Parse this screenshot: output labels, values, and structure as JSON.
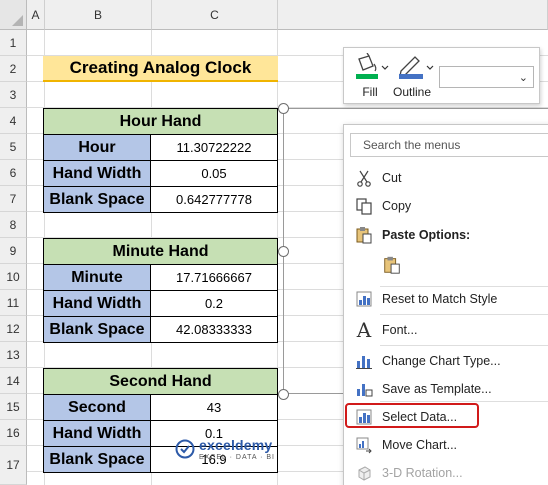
{
  "sheet": {
    "columns": [
      "A",
      "B",
      "C"
    ],
    "rows": [
      "1",
      "2",
      "3",
      "4",
      "5",
      "6",
      "7",
      "8",
      "9",
      "10",
      "11",
      "12",
      "13",
      "14",
      "15",
      "16",
      "17"
    ],
    "title": "Creating Analog Clock"
  },
  "tables": {
    "hour": {
      "header": "Hour Hand",
      "rows": [
        {
          "label": "Hour",
          "value": "11.30722222"
        },
        {
          "label": "Hand Width",
          "value": "0.05"
        },
        {
          "label": "Blank Space",
          "value": "0.642777778"
        }
      ]
    },
    "minute": {
      "header": "Minute Hand",
      "rows": [
        {
          "label": "Minute",
          "value": "17.71666667"
        },
        {
          "label": "Hand Width",
          "value": "0.2"
        },
        {
          "label": "Blank Space",
          "value": "42.08333333"
        }
      ]
    },
    "second": {
      "header": "Second Hand",
      "rows": [
        {
          "label": "Second",
          "value": "43"
        },
        {
          "label": "Hand Width",
          "value": "0.1"
        },
        {
          "label": "Blank Space",
          "value": "16.9"
        }
      ]
    }
  },
  "mini_toolbar": {
    "fill_label": "Fill",
    "outline_label": "Outline",
    "fill_color": "#00b050",
    "outline_color": "#4472c4"
  },
  "context_menu": {
    "search_placeholder": "Search the menus",
    "items": {
      "cut": "Cut",
      "copy": "Copy",
      "paste_options": "Paste Options:",
      "reset": "Reset to Match Style",
      "font": "Font...",
      "change_chart_type": "Change Chart Type...",
      "save_as_template": "Save as Template...",
      "select_data": "Select Data...",
      "move_chart": "Move Chart...",
      "rotation_3d": "3-D Rotation..."
    }
  },
  "watermark": {
    "name": "exceldemy",
    "tagline": "EXCEL · DATA · BI"
  }
}
